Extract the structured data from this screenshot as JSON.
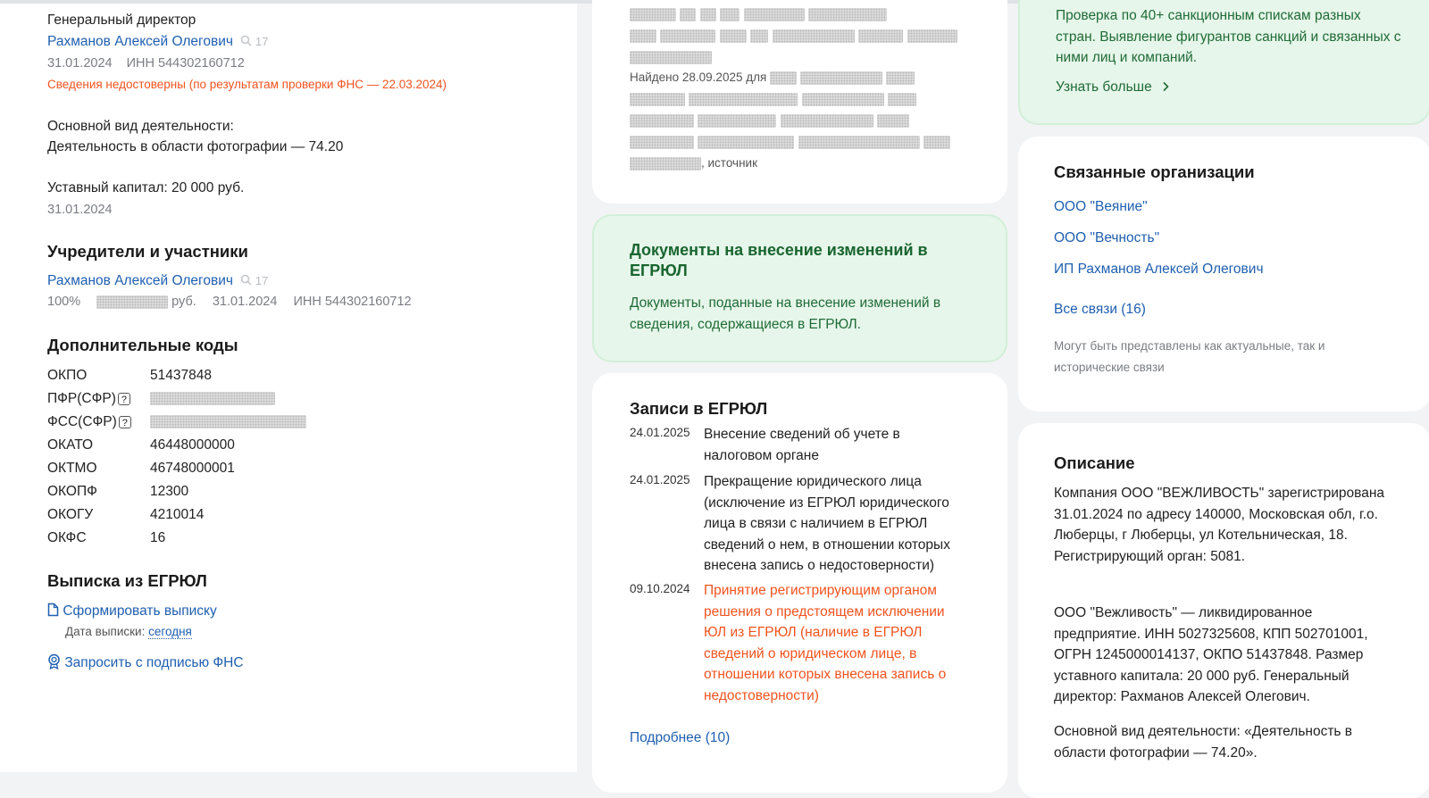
{
  "left": {
    "director": {
      "title": "Генеральный директор",
      "name": "Рахманов Алексей Олегович",
      "search_count": "17",
      "date": "31.01.2024",
      "inn": "ИНН 544302160712",
      "warning": "Сведения недостоверны (по результатам проверки ФНС — 22.03.2024)"
    },
    "activity": {
      "label": "Основной вид деятельности:",
      "value": "Деятельность в области фотографии — 74.20"
    },
    "capital": {
      "label": "Уставный капитал: 20 000 руб.",
      "date": "31.01.2024"
    },
    "founders": {
      "heading": "Учредители и участники",
      "name": "Рахманов Алексей Олегович",
      "search_count": "17",
      "share": "100%",
      "rub": "руб.",
      "date": "31.01.2024",
      "inn": "ИНН 544302160712"
    },
    "codes": {
      "heading": "Дополнительные коды",
      "rows": [
        {
          "label": "ОКПО",
          "value": "51437848"
        },
        {
          "label": "ПФР(СФР)",
          "value": ""
        },
        {
          "label": "ФСС(СФР)",
          "value": ""
        },
        {
          "label": "ОКАТО",
          "value": "46448000000"
        },
        {
          "label": "ОКТМО",
          "value": "46748000001"
        },
        {
          "label": "ОКОПФ",
          "value": "12300"
        },
        {
          "label": "ОКОГУ",
          "value": "4210014"
        },
        {
          "label": "ОКФС",
          "value": "16"
        }
      ],
      "help_glyph": "?"
    },
    "extract": {
      "heading": "Выписка из ЕГРЮЛ",
      "form_link": "Сформировать выписку",
      "date_label": "Дата выписки:",
      "date_value": "сегодня",
      "request_link": "Запросить с подписью ФНС"
    }
  },
  "middle": {
    "top_card": {
      "found_prefix": "Найдено 28.09.2025 для",
      "source": ", источник"
    },
    "docs_card": {
      "title": "Документы на внесение изменений в ЕГРЮЛ",
      "text": "Документы, поданные на внесение изменений в сведения, содержащиеся в ЕГРЮЛ."
    },
    "records": {
      "heading": "Записи в ЕГРЮЛ",
      "items": [
        {
          "date": "24.01.2025",
          "text": "Внесение сведений об учете в налоговом органе",
          "color": "#222222"
        },
        {
          "date": "24.01.2025",
          "text": "Прекращение юридического лица (исключение из ЕГРЮЛ юридического лица в связи с наличием в ЕГРЮЛ сведений о нем, в отношении которых внесена запись о недостоверности)",
          "color": "#222222"
        },
        {
          "date": "09.10.2024",
          "text": "Принятие регистрирующим органом решения о предстоящем исключении ЮЛ из ЕГРЮЛ (наличие в ЕГРЮЛ сведений о юридическом лице, в отношении которых внесена запись о недостоверности)",
          "color": "#f0531f"
        }
      ],
      "more_link": "Подробнее (10)"
    }
  },
  "right": {
    "sanctions_card": {
      "text": "Проверка по 40+ санкционным спискам разных стран. Выявление фигурантов санкций и связанных с ними лиц и компаний.",
      "link": "Узнать больше"
    },
    "related": {
      "heading": "Связанные организации",
      "items": [
        "ООО \"Веяние\"",
        "ООО \"Вечность\"",
        "ИП Рахманов Алексей Олегович"
      ],
      "all_link": "Все связи (16)",
      "note": "Могут быть представлены как актуальные, так и исторические связи"
    },
    "description": {
      "heading": "Описание",
      "p1": "Компания ООО \"ВЕЖЛИВОСТЬ\" зарегистрирована 31.01.2024 по адресу 140000, Московская обл, г.о. Люберцы, г Люберцы, ул Котельническая, 18. Регистрирующий орган: 5081.",
      "p2": "ООО \"Вежливость\" — ликвидированное предприятие. ИНН 5027325608, КПП 502701001, ОГРН 1245000014137, ОКПО 51437848. Размер уставного капитала: 20 000 руб. Генеральный директор: Рахманов Алексей Олегович.",
      "p3": "Основной вид деятельности: «Деятельность в области фотографии — 74.20»."
    }
  },
  "colors": {
    "link": "#1f5fb0",
    "warning": "#f0531f",
    "green_card_bg": "#e6f6ea",
    "green_text": "#1f6b36"
  }
}
